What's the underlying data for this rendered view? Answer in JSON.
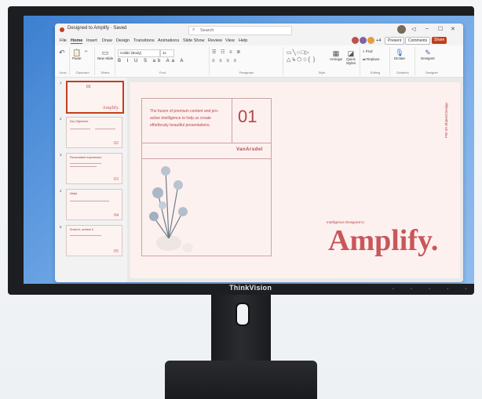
{
  "window": {
    "doc_title": "Designed to Amplify · Saved",
    "search_placeholder": "Search",
    "minimize": "–",
    "maximize": "☐",
    "close": "✕"
  },
  "menu": {
    "items": [
      "File",
      "Home",
      "Insert",
      "Draw",
      "Design",
      "Transitions",
      "Animations",
      "Slide Show",
      "Review",
      "View",
      "Help"
    ],
    "active": "Home",
    "collab_count": "+4",
    "present_label": "Present",
    "comments_label": "Comments",
    "share_label": "Share"
  },
  "ribbon": {
    "undo_label": "Undo",
    "paste_label": "Paste",
    "clipboard_label": "Clipboard",
    "new_slide_label": "New Slide",
    "reuse_slides_label": "Reuse Slides",
    "slides_group_label": "Slides",
    "font_name": "Calibri (Body)",
    "font_size": "11",
    "format_row": "B I U S ab Aa A",
    "font_group_label": "Font",
    "paragraph_group_label": "Paragraph",
    "arrange_label": "Arrange",
    "quick_styles_label": "Quick Styles",
    "drawing_group_label": "Style",
    "find_label": "Find",
    "replace_label": "Replace",
    "editing_group_label": "Editing",
    "dictate_label": "Dictate",
    "voice_group_label": "Dictation",
    "designer_label": "Designer",
    "designer_group_label": "Designer"
  },
  "thumbnails": [
    {
      "number": "1",
      "title": "01",
      "big": "Amplify."
    },
    {
      "number": "2",
      "title": "Key Objectives",
      "big": "02"
    },
    {
      "number": "3",
      "title": "Personalized experiences",
      "big": "03"
    },
    {
      "number": "4",
      "title": "Adapt",
      "big": "04"
    },
    {
      "number": "5",
      "title": "Dream it, achieve it",
      "big": "05"
    }
  ],
  "slide": {
    "body_text": "The fusion of premium content and pro-active intelligence to help us create effortlessly beautiful presentations.",
    "number": "01",
    "brand": "VanArsdel",
    "tagline": "Intelligence Designed to",
    "headline": "Amplify.",
    "vertical_text": "PW  VA Shared Design"
  },
  "monitor": {
    "brand_logo": "ThinkVision"
  }
}
